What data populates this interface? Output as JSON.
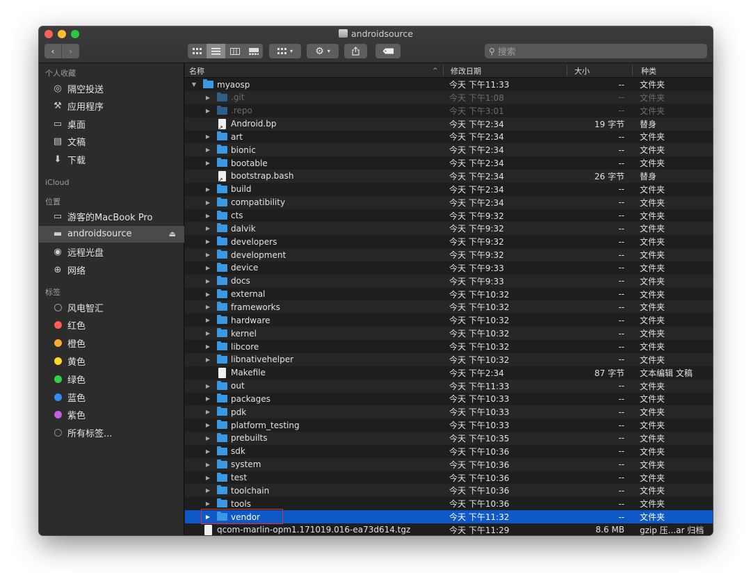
{
  "window": {
    "title": "androidsource",
    "colors": {
      "close": "#fe5f57",
      "minimize": "#febc2e",
      "zoom": "#28c840",
      "selection": "#0d59c8"
    }
  },
  "toolbar": {
    "back_icon": "chevron-left-icon",
    "forward_icon": "chevron-right-icon",
    "view_modes": [
      "icon-view",
      "list-view",
      "column-view",
      "gallery-view"
    ],
    "group_label": "group-icon",
    "action_label": "gear-icon",
    "share_label": "share-icon",
    "tag_label": "tag-icon",
    "search_placeholder": "搜索"
  },
  "sidebar": {
    "favorites_header": "个人收藏",
    "favorites": [
      {
        "label": "隔空投送",
        "icon": "airdrop-icon"
      },
      {
        "label": "应用程序",
        "icon": "applications-icon"
      },
      {
        "label": "桌面",
        "icon": "desktop-icon"
      },
      {
        "label": "文稿",
        "icon": "documents-icon"
      },
      {
        "label": "下载",
        "icon": "downloads-icon"
      }
    ],
    "icloud_header": "iCloud",
    "locations_header": "位置",
    "locations": [
      {
        "label": "游客的MacBook Pro",
        "icon": "laptop-icon"
      },
      {
        "label": "androidsource",
        "icon": "disk-icon",
        "selected": true
      },
      {
        "label": "远程光盘",
        "icon": "disc-icon"
      },
      {
        "label": "网络",
        "icon": "network-icon"
      }
    ],
    "tags_header": "标签",
    "tags": [
      {
        "label": "风电智汇",
        "color": "#2c2c2c"
      },
      {
        "label": "红色",
        "color": "#fe5c55"
      },
      {
        "label": "橙色",
        "color": "#fdaa2e"
      },
      {
        "label": "黄色",
        "color": "#fdd927"
      },
      {
        "label": "绿色",
        "color": "#32d14a"
      },
      {
        "label": "蓝色",
        "color": "#2f8ff7"
      },
      {
        "label": "紫色",
        "color": "#c45ee3"
      },
      {
        "label": "所有标签...",
        "color": "#7a7a7a"
      }
    ]
  },
  "columns": {
    "name": "名称",
    "date": "修改日期",
    "size": "大小",
    "kind": "种类"
  },
  "rows": [
    {
      "name": "myaosp",
      "date": "今天 下午11:33",
      "size": "--",
      "kind": "文件夹",
      "type": "folder",
      "level": 0,
      "expanded": true
    },
    {
      "name": ".git",
      "date": "今天 下午1:08",
      "size": "--",
      "kind": "文件夹",
      "type": "folder",
      "level": 1,
      "dim": true
    },
    {
      "name": ".repo",
      "date": "今天 下午3:01",
      "size": "--",
      "kind": "文件夹",
      "type": "folder",
      "level": 1,
      "dim": true
    },
    {
      "name": "Android.bp",
      "date": "今天 下午2:34",
      "size": "19 字节",
      "kind": "替身",
      "type": "alias",
      "level": 1
    },
    {
      "name": "art",
      "date": "今天 下午2:34",
      "size": "--",
      "kind": "文件夹",
      "type": "folder",
      "level": 1
    },
    {
      "name": "bionic",
      "date": "今天 下午2:34",
      "size": "--",
      "kind": "文件夹",
      "type": "folder",
      "level": 1
    },
    {
      "name": "bootable",
      "date": "今天 下午2:34",
      "size": "--",
      "kind": "文件夹",
      "type": "folder",
      "level": 1
    },
    {
      "name": "bootstrap.bash",
      "date": "今天 下午2:34",
      "size": "26 字节",
      "kind": "替身",
      "type": "alias",
      "level": 1
    },
    {
      "name": "build",
      "date": "今天 下午2:34",
      "size": "--",
      "kind": "文件夹",
      "type": "folder",
      "level": 1
    },
    {
      "name": "compatibility",
      "date": "今天 下午2:34",
      "size": "--",
      "kind": "文件夹",
      "type": "folder",
      "level": 1
    },
    {
      "name": "cts",
      "date": "今天 下午9:32",
      "size": "--",
      "kind": "文件夹",
      "type": "folder",
      "level": 1
    },
    {
      "name": "dalvik",
      "date": "今天 下午9:32",
      "size": "--",
      "kind": "文件夹",
      "type": "folder",
      "level": 1
    },
    {
      "name": "developers",
      "date": "今天 下午9:32",
      "size": "--",
      "kind": "文件夹",
      "type": "folder",
      "level": 1
    },
    {
      "name": "development",
      "date": "今天 下午9:32",
      "size": "--",
      "kind": "文件夹",
      "type": "folder",
      "level": 1
    },
    {
      "name": "device",
      "date": "今天 下午9:33",
      "size": "--",
      "kind": "文件夹",
      "type": "folder",
      "level": 1
    },
    {
      "name": "docs",
      "date": "今天 下午9:33",
      "size": "--",
      "kind": "文件夹",
      "type": "folder",
      "level": 1
    },
    {
      "name": "external",
      "date": "今天 下午10:32",
      "size": "--",
      "kind": "文件夹",
      "type": "folder",
      "level": 1
    },
    {
      "name": "frameworks",
      "date": "今天 下午10:32",
      "size": "--",
      "kind": "文件夹",
      "type": "folder",
      "level": 1
    },
    {
      "name": "hardware",
      "date": "今天 下午10:32",
      "size": "--",
      "kind": "文件夹",
      "type": "folder",
      "level": 1
    },
    {
      "name": "kernel",
      "date": "今天 下午10:32",
      "size": "--",
      "kind": "文件夹",
      "type": "folder",
      "level": 1
    },
    {
      "name": "libcore",
      "date": "今天 下午10:32",
      "size": "--",
      "kind": "文件夹",
      "type": "folder",
      "level": 1
    },
    {
      "name": "libnativehelper",
      "date": "今天 下午10:32",
      "size": "--",
      "kind": "文件夹",
      "type": "folder",
      "level": 1
    },
    {
      "name": "Makefile",
      "date": "今天 下午2:34",
      "size": "87 字节",
      "kind": "文本编辑 文稿",
      "type": "file",
      "level": 1
    },
    {
      "name": "out",
      "date": "今天 下午11:33",
      "size": "--",
      "kind": "文件夹",
      "type": "folder",
      "level": 1
    },
    {
      "name": "packages",
      "date": "今天 下午10:33",
      "size": "--",
      "kind": "文件夹",
      "type": "folder",
      "level": 1
    },
    {
      "name": "pdk",
      "date": "今天 下午10:33",
      "size": "--",
      "kind": "文件夹",
      "type": "folder",
      "level": 1
    },
    {
      "name": "platform_testing",
      "date": "今天 下午10:33",
      "size": "--",
      "kind": "文件夹",
      "type": "folder",
      "level": 1
    },
    {
      "name": "prebuilts",
      "date": "今天 下午10:35",
      "size": "--",
      "kind": "文件夹",
      "type": "folder",
      "level": 1
    },
    {
      "name": "sdk",
      "date": "今天 下午10:36",
      "size": "--",
      "kind": "文件夹",
      "type": "folder",
      "level": 1
    },
    {
      "name": "system",
      "date": "今天 下午10:36",
      "size": "--",
      "kind": "文件夹",
      "type": "folder",
      "level": 1
    },
    {
      "name": "test",
      "date": "今天 下午10:36",
      "size": "--",
      "kind": "文件夹",
      "type": "folder",
      "level": 1
    },
    {
      "name": "toolchain",
      "date": "今天 下午10:36",
      "size": "--",
      "kind": "文件夹",
      "type": "folder",
      "level": 1
    },
    {
      "name": "tools",
      "date": "今天 下午10:36",
      "size": "--",
      "kind": "文件夹",
      "type": "folder",
      "level": 1
    },
    {
      "name": "vendor",
      "date": "今天 下午11:32",
      "size": "--",
      "kind": "文件夹",
      "type": "folder",
      "level": 1,
      "selected": true
    },
    {
      "name": "qcom-marlin-opm1.171019.016-ea73d614.tgz",
      "date": "今天 下午11:29",
      "size": "8.6 MB",
      "kind": "gzip 压...ar 归档",
      "type": "file",
      "level": 0
    }
  ]
}
